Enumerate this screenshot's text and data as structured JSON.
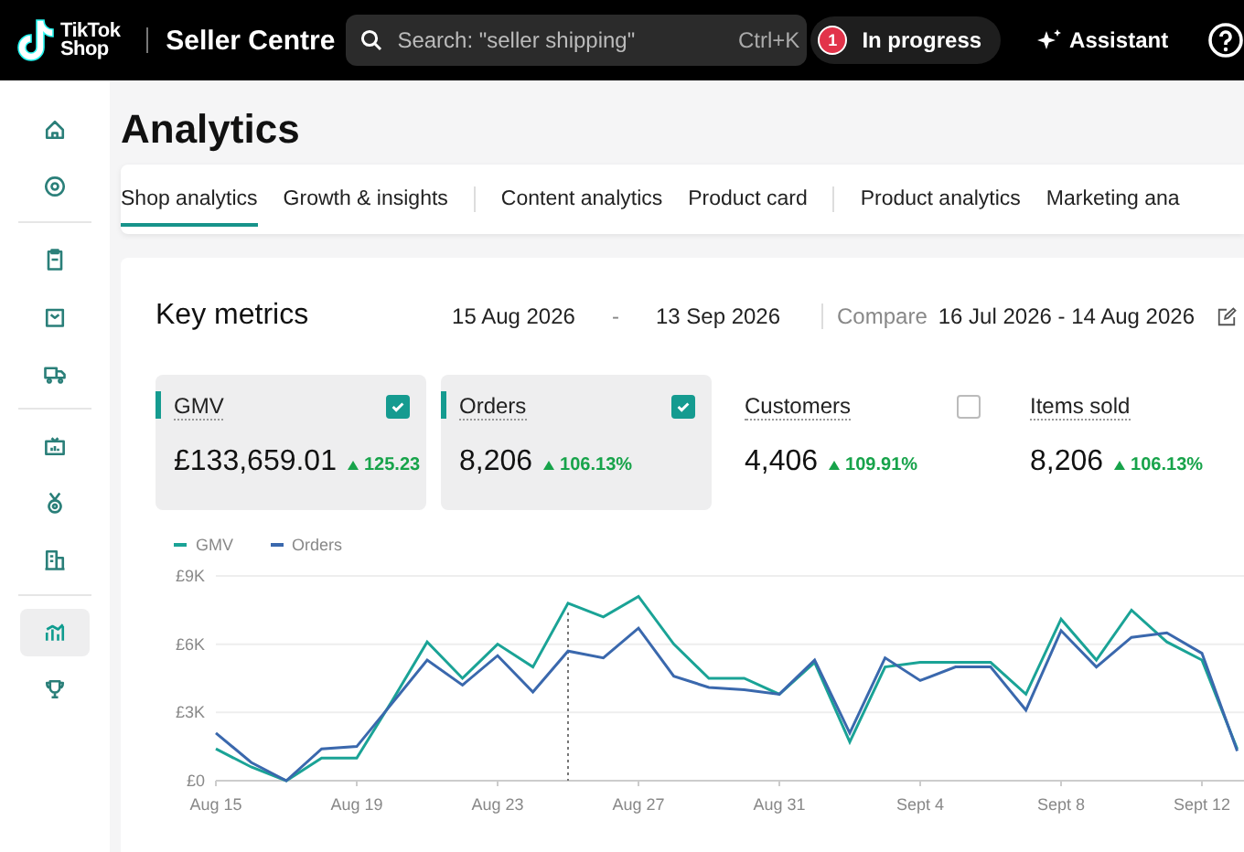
{
  "header": {
    "logo": {
      "line_1": "TikTok",
      "line_2": "Shop"
    },
    "product": "Seller Centre",
    "search": {
      "placeholder": "Search: \"seller shipping\"",
      "shortcut": "Ctrl+K"
    },
    "tasks": {
      "label": "In progress",
      "badge": "1"
    },
    "assistant": "Assistant"
  },
  "sidebar": {
    "groups": [
      [
        {
          "selected": false
        },
        {
          "selected": false
        }
      ],
      [
        {
          "selected": false
        },
        {
          "selected": false
        },
        {
          "selected": false
        }
      ],
      [
        {
          "selected": false
        },
        {
          "selected": false
        },
        {
          "selected": false
        }
      ],
      [
        {
          "selected": true
        },
        {
          "selected": false
        }
      ]
    ]
  },
  "page": {
    "title": "Analytics",
    "tab_groups": [
      [
        {
          "label": "Shop analytics",
          "selected": true
        },
        {
          "label": "Growth & insights",
          "selected": false
        }
      ],
      [
        {
          "label": "Content analytics",
          "selected": false
        },
        {
          "label": "Product card",
          "selected": false
        }
      ],
      [
        {
          "label": "Product analytics",
          "selected": false
        },
        {
          "label": "Marketing ana",
          "selected": false
        }
      ]
    ]
  },
  "key_metrics": {
    "title": "Key metrics",
    "date_from": "15 Aug 2026",
    "date_separator": "-",
    "date_to": "13 Sep 2026",
    "compare_label": "Compare",
    "compare_range": "16 Jul 2026 - 14 Aug 2026",
    "metrics": [
      {
        "label": "GMV",
        "checked": true,
        "value": "£133,659.01",
        "change": "125.23"
      },
      {
        "label": "Orders",
        "checked": true,
        "value": "8,206",
        "change": "106.13%"
      },
      {
        "label": "Customers",
        "checked": false,
        "value": "4,406",
        "change": "109.91%"
      },
      {
        "label": "Items sold",
        "value": "8,206",
        "change": "106.13%"
      }
    ],
    "chart_data": {
      "type": "line",
      "categories": [
        "Aug 15",
        null,
        null,
        null,
        "Aug 19",
        null,
        null,
        null,
        "Aug 23",
        null,
        null,
        null,
        "Aug 27",
        null,
        null,
        null,
        "Aug 31",
        null,
        null,
        null,
        "Sept 4",
        null,
        null,
        null,
        "Sept 8",
        null,
        null,
        null,
        "Sept 12",
        null
      ],
      "series": [
        {
          "name": "GMV",
          "color": "#1aa396",
          "values": [
            1.4,
            0.6,
            0,
            1.0,
            1.0,
            3.5,
            6.1,
            4.5,
            6.0,
            5.0,
            7.8,
            7.2,
            8.1,
            6.0,
            4.5,
            4.5,
            3.8,
            5.2,
            1.7,
            5.0,
            5.2,
            5.2,
            5.2,
            3.8,
            7.1,
            5.3,
            7.5,
            6.1,
            5.3,
            1.4
          ]
        },
        {
          "name": "Orders",
          "color": "#3a68ad",
          "values": [
            2.1,
            0.8,
            0,
            1.4,
            1.5,
            3.4,
            5.3,
            4.2,
            5.5,
            3.9,
            5.7,
            5.4,
            6.7,
            4.6,
            4.1,
            4.0,
            3.8,
            5.3,
            2.1,
            5.4,
            4.4,
            5.0,
            5.0,
            3.1,
            6.6,
            5.0,
            6.3,
            6.5,
            5.6,
            1.3
          ]
        }
      ],
      "ylim": [
        0,
        9
      ],
      "yticks": [
        {
          "value": 0,
          "label": "£0"
        },
        {
          "value": 3,
          "label": "£3K"
        },
        {
          "value": 6,
          "label": "£6K"
        },
        {
          "value": 9,
          "label": "£9K"
        }
      ]
    }
  }
}
